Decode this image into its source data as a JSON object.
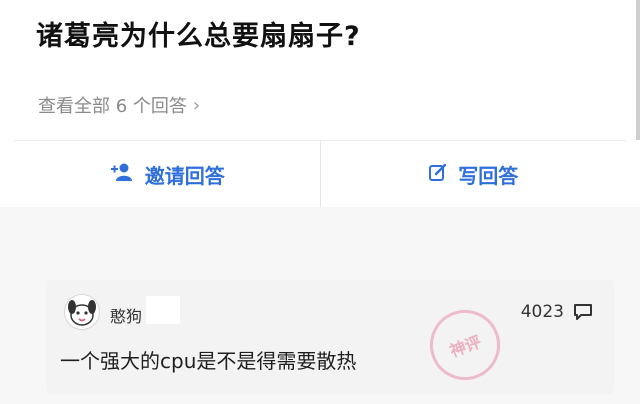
{
  "question": {
    "title": "诸葛亮为什么总要扇扇子?",
    "view_all_label": "查看全部 6 个回答"
  },
  "actions": {
    "invite_label": "邀请回答",
    "write_label": "写回答"
  },
  "comment": {
    "username": "憨狗",
    "like_count": "4023",
    "text": "一个强大的cpu是不是得需要散热",
    "stamp_text": "神评"
  },
  "colors": {
    "accent": "#2f6fdc",
    "muted": "#8a8a8a"
  },
  "icons": {
    "invite": "add-user-icon",
    "write": "edit-icon",
    "chevron": "chevron-right-icon",
    "comment": "comment-bubble-icon"
  }
}
